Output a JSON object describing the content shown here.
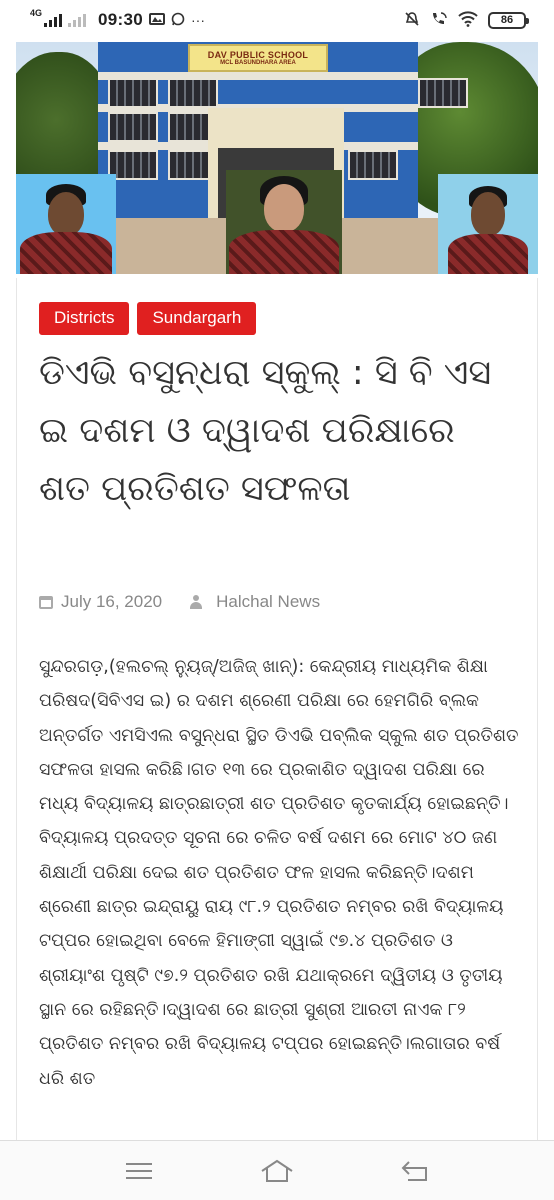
{
  "status_bar": {
    "network": "4G",
    "time": "09:30",
    "battery": "86"
  },
  "hero": {
    "school_name": "DAV PUBLIC SCHOOL",
    "school_area": "MCL BASUNDHARA AREA"
  },
  "article": {
    "tags": [
      "Districts",
      "Sundargarh"
    ],
    "title": "ଡିଏଭି ବସୁନ୍ଧରା ସ୍କୁଲ୍ : ସି ବି ଏସ ଇ ଦଶମ ଓ ଦ୍ୱାଦଶ ପରିକ୍ଷାରେ ଶତ ପ୍ରତିଶତ ସଫଳତା",
    "date": "July 16, 2020",
    "author": "Halchal News",
    "body": "ସୁନ୍ଦରଗଡ଼,(ହଲଚଲ୍ ନ୍ୟୁଜ୍/ଅଜିଜ୍ ଖାନ୍): କେନ୍ଦ୍ରୀୟ ମାଧ୍ୟମିକ ଶିକ୍ଷା ପରିଷଦ(ସିବିଏସ ଇ) ର ଦଶମ  ଶ୍ରେଣୀ ପରିକ୍ଷା ରେ ହେମଗିରି ବ୍ଲକ ଅନ୍ତର୍ଗତ ଏମସିଏଲ ବସୁନ୍ଧରା ସ୍ଥିତ ଡିଏଭି ପବ୍ଲିକ ସ୍କୁଲ ଶତ ପ୍ରତିଶତ ସଫଳତା ହାସଲ କରିଛି।ଗତ ୧୩ ରେ ପ୍ରକାଶିତ ଦ୍ୱାଦଶ ପରିକ୍ଷା ରେ ମଧ୍ୟ ବିଦ୍ୟାଳୟ ଛାତ୍ରଛାତ୍ରୀ ଶତ ପ୍ରତିଶତ କୃତକାର୍ଯ୍ୟ ହୋଇଛନ୍ତି।ବିଦ୍ୟାଳୟ ପ୍ରଦତ୍ତ ସୂଚନା ରେ ଚଳିତ ବର୍ଷ ଦଶମ ରେ ମୋଟ ୪୦ ଜଣ ଶିକ୍ଷାର୍ଥୀ ପରିକ୍ଷା ଦେଇ ଶତ ପ୍ରତିଶତ ଫଳ ହାସଲ କରିଛନ୍ତି।ଦଶମ ଶ୍ରେଣୀ ଛାତ୍ର ଇନ୍ଦ୍ରାୟୁ ରାୟ ୯୮.୨ ପ୍ରତିଶତ ନମ୍ବର ରଖି ବିଦ୍ୟାଳୟ ଟପ୍ପର ହୋଇଥିବା ବେଳେ  ହିମାଙ୍ଗୀ ସ୍ୱାଇଁ ୯୭.୪ ପ୍ରତିଶତ ଓ ଶ୍ରୀୟାଂଶ ପୃଷ୍ଟି ୯୭.୨ ପ୍ରତିଶତ ରଖି ଯଥାକ୍ରମେ ଦ୍ୱିତୀୟ ଓ ତୃତୀୟ ସ୍ଥାନ ରେ ରହିଛନ୍ତି।ଦ୍ୱାଦଶ ରେ ଛାତ୍ରୀ ସୁଶ୍ରୀ ଆରତୀ ନାଏକ ୮୨ ପ୍ରତିଶତ ନମ୍ବର ରଖି ବିଦ୍ୟାଳୟ ଟପ୍ପର ହୋଇଛନ୍ତି।ଲଗାତାର ବର୍ଷ ଧରି ଶତ"
  },
  "colors": {
    "tag_bg": "#e02020",
    "meta_text": "#888888"
  }
}
